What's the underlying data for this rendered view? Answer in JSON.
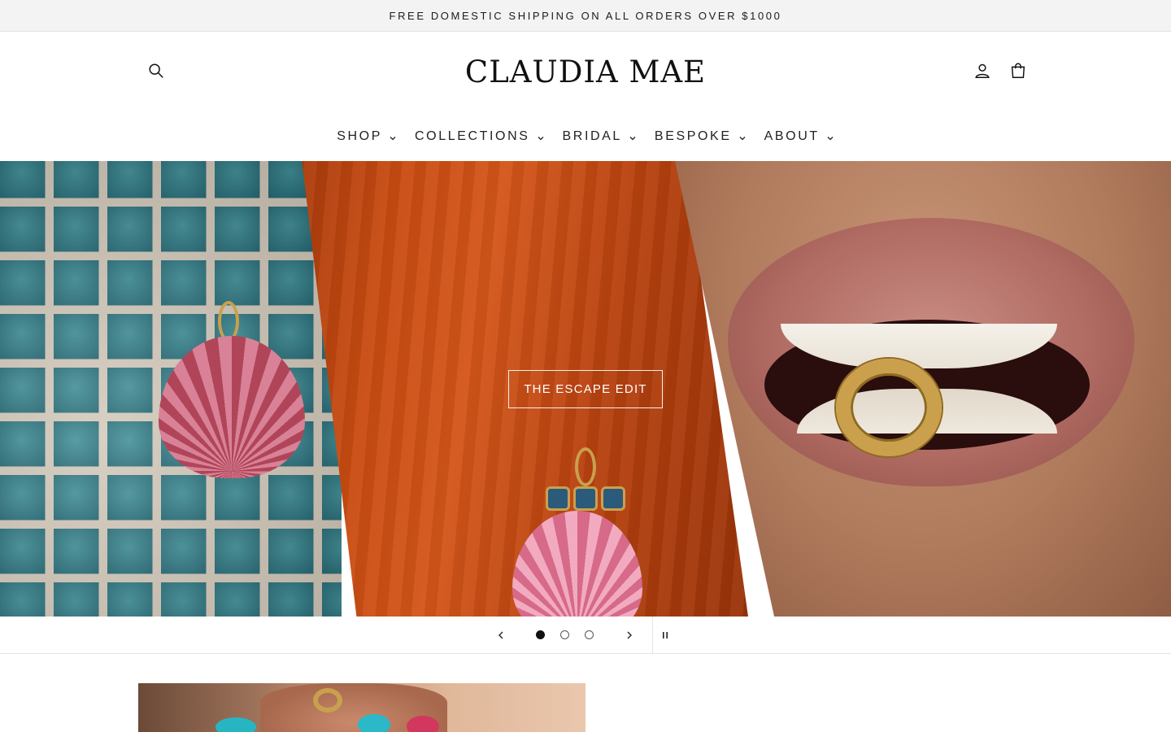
{
  "announcement": {
    "text": "FREE DOMESTIC SHIPPING ON ALL ORDERS OVER $1000"
  },
  "header": {
    "logo": "CLAUDIA MAE",
    "icons": {
      "search": "search-icon",
      "account": "account-icon",
      "cart": "cart-icon"
    }
  },
  "nav": {
    "items": [
      {
        "label": "SHOP"
      },
      {
        "label": "COLLECTIONS"
      },
      {
        "label": "BRIDAL"
      },
      {
        "label": "BESPOKE"
      },
      {
        "label": "ABOUT"
      }
    ]
  },
  "hero": {
    "cta_label": "THE ESCAPE EDIT",
    "slides_total": 3,
    "active_slide": 1
  },
  "slider": {
    "icons": {
      "prev": "chevron-left-icon",
      "next": "chevron-right-icon",
      "pause": "pause-icon"
    }
  },
  "colors": {
    "announcement_bg": "#f3f3f3",
    "text": "#1a1a1a",
    "hero_button_border": "#f5f0e8"
  }
}
